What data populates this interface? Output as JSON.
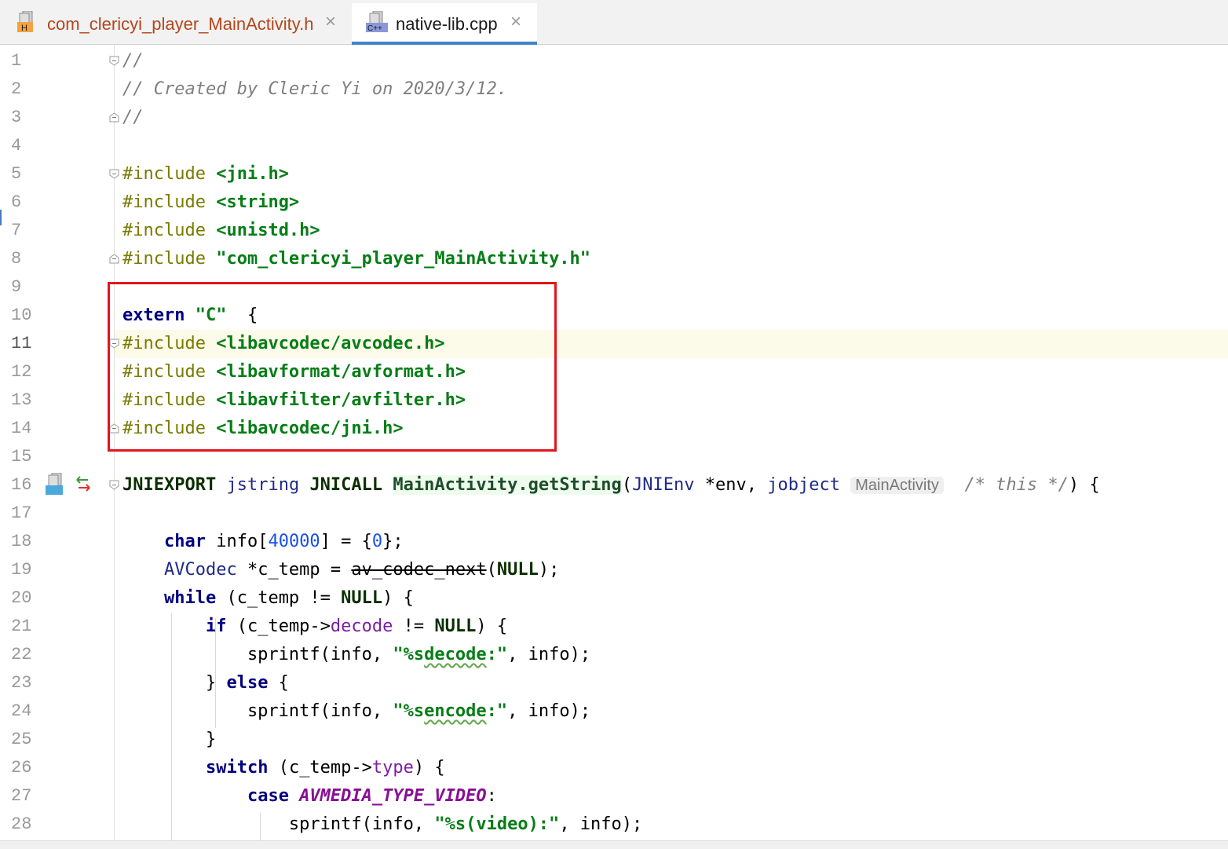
{
  "tabs": [
    {
      "label": "com_clericyi_player_MainActivity.h",
      "icon": "header-file-icon",
      "icon_text": "H",
      "active": false
    },
    {
      "label": "native-lib.cpp",
      "icon": "cpp-file-icon",
      "icon_text": "C++",
      "active": true
    }
  ],
  "tab_close": "×",
  "colors": {
    "highlight_box": "#e3141c",
    "active_tab_underline": "#4083c9",
    "current_line": "#fcfae8"
  },
  "current_line": 11,
  "lines": [
    {
      "n": "1",
      "parts": [
        [
          "cmt",
          "//"
        ]
      ],
      "fold": "open"
    },
    {
      "n": "2",
      "parts": [
        [
          "cmt",
          "// Created by Cleric Yi on 2020/3/12."
        ]
      ]
    },
    {
      "n": "3",
      "parts": [
        [
          "cmt",
          "//"
        ]
      ],
      "fold": "close"
    },
    {
      "n": "4",
      "parts": []
    },
    {
      "n": "5",
      "parts": [
        [
          "pp",
          "#include "
        ],
        [
          "str",
          "<jni.h>"
        ]
      ],
      "fold": "open"
    },
    {
      "n": "6",
      "parts": [
        [
          "pp",
          "#include "
        ],
        [
          "str",
          "<string>"
        ]
      ]
    },
    {
      "n": "7",
      "parts": [
        [
          "pp",
          "#include "
        ],
        [
          "str",
          "<unistd.h>"
        ]
      ]
    },
    {
      "n": "8",
      "parts": [
        [
          "pp",
          "#include "
        ],
        [
          "str",
          "\"com_clericyi_player_MainActivity.h\""
        ]
      ],
      "fold": "close"
    },
    {
      "n": "9",
      "parts": []
    },
    {
      "n": "10",
      "parts": [
        [
          "kw",
          "extern "
        ],
        [
          "str",
          "\"C\""
        ],
        [
          "",
          "  {"
        ]
      ]
    },
    {
      "n": "11",
      "parts": [
        [
          "pp",
          "#include "
        ],
        [
          "str",
          "<libavcodec/avcodec.h>"
        ]
      ],
      "fold": "open"
    },
    {
      "n": "12",
      "parts": [
        [
          "pp",
          "#include "
        ],
        [
          "str",
          "<libavformat/avformat.h>"
        ]
      ]
    },
    {
      "n": "13",
      "parts": [
        [
          "pp",
          "#include "
        ],
        [
          "str",
          "<libavfilter/avfilter.h>"
        ]
      ]
    },
    {
      "n": "14",
      "parts": [
        [
          "pp",
          "#include "
        ],
        [
          "str",
          "<libavcodec/jni.h>"
        ]
      ],
      "fold": "close"
    },
    {
      "n": "15",
      "parts": []
    },
    {
      "n": "16",
      "parts": [
        [
          "macb",
          "JNIEXPORT"
        ],
        [
          "",
          " "
        ],
        [
          "type",
          "jstring"
        ],
        [
          "",
          " "
        ],
        [
          "macb",
          "JNICALL"
        ],
        [
          "",
          " "
        ],
        [
          "fn",
          "MainActivity.getString"
        ],
        [
          "",
          "("
        ],
        [
          "type",
          "JNIEnv"
        ],
        [
          "",
          " *env, "
        ],
        [
          "type",
          "jobject"
        ],
        [
          "",
          " "
        ],
        [
          "hint",
          "MainActivity"
        ],
        [
          "",
          "  "
        ],
        [
          "cmt",
          "/* this */"
        ],
        [
          "",
          ") {"
        ]
      ],
      "fold": "open"
    },
    {
      "n": "17",
      "parts": []
    },
    {
      "n": "18",
      "parts": [
        [
          "",
          "    "
        ],
        [
          "kw",
          "char"
        ],
        [
          "",
          " info["
        ],
        [
          "num",
          "40000"
        ],
        [
          "",
          "] = {"
        ],
        [
          "num",
          "0"
        ],
        [
          "",
          "};"
        ]
      ]
    },
    {
      "n": "19",
      "parts": [
        [
          "",
          "    "
        ],
        [
          "type",
          "AVCodec"
        ],
        [
          "",
          " *c_temp = "
        ],
        [
          "strike",
          "av_codec_next"
        ],
        [
          "",
          "("
        ],
        [
          "macb",
          "NULL"
        ],
        [
          "",
          ");"
        ]
      ]
    },
    {
      "n": "20",
      "parts": [
        [
          "",
          "    "
        ],
        [
          "kw",
          "while"
        ],
        [
          "",
          " (c_temp != "
        ],
        [
          "macb",
          "NULL"
        ],
        [
          "",
          ") {"
        ]
      ]
    },
    {
      "n": "21",
      "parts": [
        [
          "",
          "        "
        ],
        [
          "kw",
          "if"
        ],
        [
          "",
          " (c_temp->"
        ],
        [
          "fld",
          "decode"
        ],
        [
          "",
          " != "
        ],
        [
          "macb",
          "NULL"
        ],
        [
          "",
          ") {"
        ]
      ]
    },
    {
      "n": "22",
      "parts": [
        [
          "",
          "            sprintf(info, "
        ],
        [
          "str",
          "\"%s"
        ],
        [
          "strwarn",
          "decode"
        ],
        [
          "str",
          ":\""
        ],
        [
          "",
          ", info);"
        ]
      ]
    },
    {
      "n": "23",
      "parts": [
        [
          "",
          "        } "
        ],
        [
          "kw",
          "else"
        ],
        [
          "",
          " {"
        ]
      ]
    },
    {
      "n": "24",
      "parts": [
        [
          "",
          "            sprintf(info, "
        ],
        [
          "str",
          "\"%s"
        ],
        [
          "strwarn",
          "encode"
        ],
        [
          "str",
          ":\""
        ],
        [
          "",
          ", info);"
        ]
      ]
    },
    {
      "n": "25",
      "parts": [
        [
          "",
          "        }"
        ]
      ]
    },
    {
      "n": "26",
      "parts": [
        [
          "",
          "        "
        ],
        [
          "kw",
          "switch"
        ],
        [
          "",
          " (c_temp->"
        ],
        [
          "fld",
          "type"
        ],
        [
          "",
          ") {"
        ]
      ]
    },
    {
      "n": "27",
      "parts": [
        [
          "",
          "            "
        ],
        [
          "kw",
          "case"
        ],
        [
          "",
          " "
        ],
        [
          "enum",
          "AVMEDIA_TYPE_VIDEO"
        ],
        [
          "",
          ":"
        ]
      ]
    },
    {
      "n": "28",
      "parts": [
        [
          "",
          "                sprintf(info, "
        ],
        [
          "str",
          "\"%s(video):\""
        ],
        [
          "",
          ", info);"
        ]
      ]
    }
  ],
  "gutter_icons": {
    "line_16": [
      "jni-method-icon",
      "navigate-arrows-icon"
    ]
  }
}
